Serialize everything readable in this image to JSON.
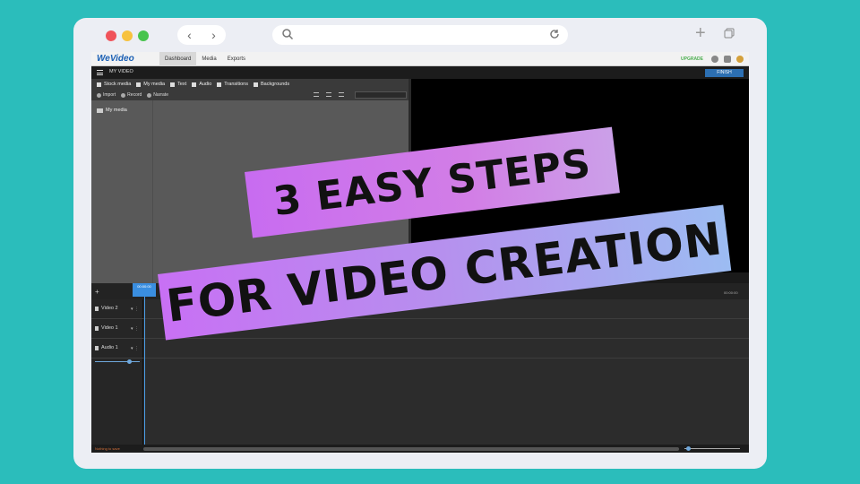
{
  "app": {
    "brand": "WeVideo",
    "tabs": [
      "Dashboard",
      "Media",
      "Exports"
    ],
    "upgrade": "UPGRADE",
    "video_title": "MY VIDEO",
    "finish": "FINISH"
  },
  "media": {
    "tabs": [
      "Stock media",
      "My media",
      "Text",
      "Audio",
      "Transitions",
      "Backgrounds"
    ],
    "actions": [
      "Import",
      "Record",
      "Narrate"
    ],
    "folder": "My media"
  },
  "timeline": {
    "playhead_time": "00:00:00",
    "ruler_end": "00:00:00",
    "tracks": [
      "Video 2",
      "Video 1",
      "Audio 1"
    ],
    "status_message": "Nothing to save"
  },
  "overlay": {
    "line1": "3 EASY STEPS",
    "line2": "FOR VIDEO CREATION"
  },
  "colors": {
    "background": "#2bbdbb",
    "accent_blue": "#2c6fb2",
    "upgrade_green": "#4caf50"
  }
}
